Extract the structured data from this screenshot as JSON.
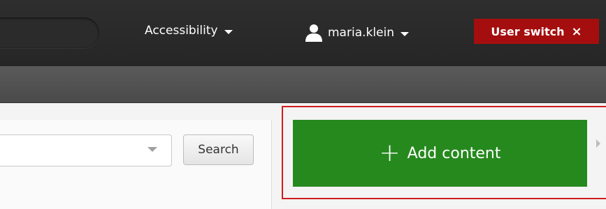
{
  "toolbar": {
    "accessibility_label": "Accessibility",
    "user_label": "maria.klein",
    "user_switch_label": "User switch",
    "user_switch_close": "×"
  },
  "search": {
    "select_value": "",
    "button_label": "Search"
  },
  "content": {
    "add_label": "Add content",
    "add_icon": "+"
  },
  "colors": {
    "topbar": "#2a2a2a",
    "user_switch": "#a50e0e",
    "add_button": "#26891e",
    "highlight_outline": "#d01c1c"
  }
}
